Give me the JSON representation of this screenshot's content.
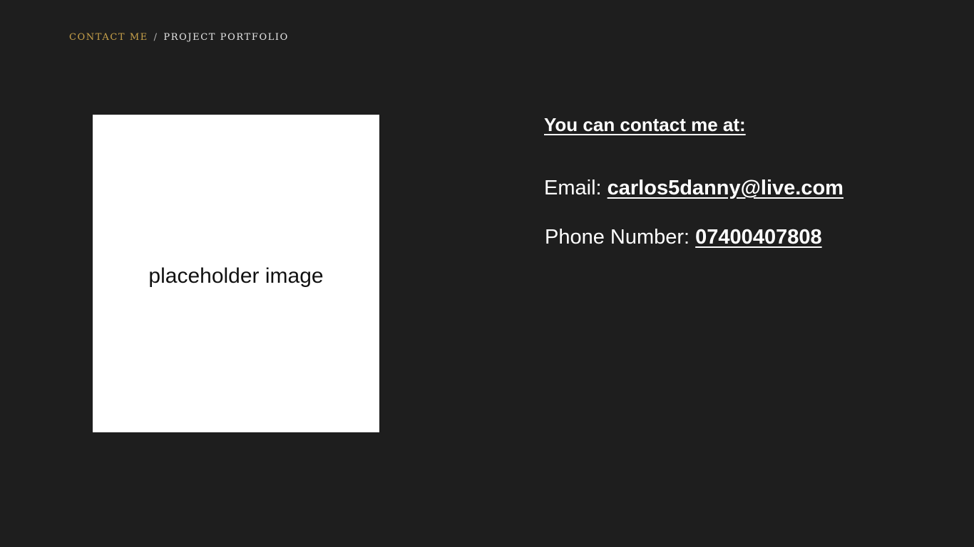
{
  "breadcrumb": {
    "current": "Contact Me",
    "separator": "/",
    "parent": "Project Portfolio"
  },
  "image": {
    "caption": "placeholder image"
  },
  "contact": {
    "heading": "You can contact me at:",
    "email_label": "Email:",
    "email_value": "carlos5danny@live.com",
    "phone_label": "Phone Number:",
    "phone_value": "07400407808"
  },
  "colors": {
    "background": "#1e1e1e",
    "accent": "#c9a24a",
    "text": "#ffffff"
  }
}
